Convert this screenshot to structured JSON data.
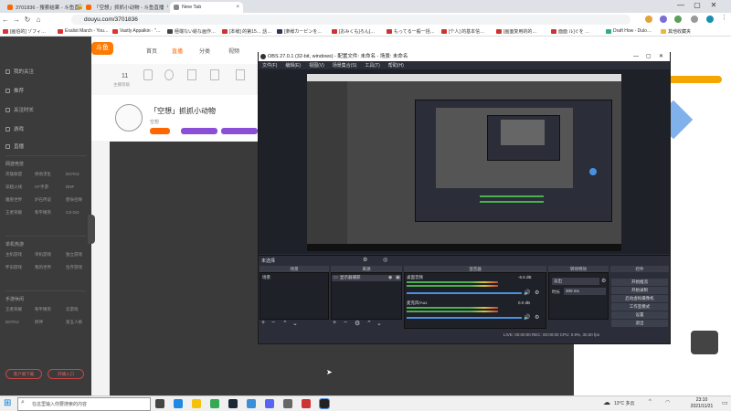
{
  "browser": {
    "tabs": [
      {
        "label": "3701836 - 搜索结果 - 斗鱼直播"
      },
      {
        "label": "「空想」抓抓小动物 - 斗鱼直播"
      },
      {
        "label": "New Tab"
      }
    ],
    "new_tab": "+",
    "address": "douyu.com/3701836",
    "bookmarks": [
      "[画伯的] ゾフィ…",
      "Exalist March - You…",
      "Vastly Appalkin · \"…",
      "極端ない絵な画作…",
      "[本様] 的第15… 話…",
      "[楽様カービンを…",
      "[おみくも]ろん[…",
      "もってる一般一括…",
      "[个人] 的基本信…",
      "[画面复用的的…",
      "面面 ル]ぐを …",
      "Draft How - Dulo…",
      "其他收藏夹"
    ],
    "window_controls": [
      "—",
      "▢",
      "✕"
    ]
  },
  "site": {
    "logo": "斗鱼",
    "nav": [
      "首页",
      "直播",
      "分类",
      "视频"
    ],
    "sidebar": {
      "items": [
        "我的关注",
        "推荐",
        "关注时长",
        "游戏",
        "直播"
      ],
      "sections": [
        {
          "title": "网游竞技",
          "cats": [
            "英雄联盟",
            "绝地求生",
            "DOTA2",
            "穿越火线",
            "CF手游",
            "DNF",
            "魔兽世界",
            "炉石传说",
            "使命召唤",
            "王者荣耀",
            "和平精英",
            "CS:GO"
          ]
        },
        {
          "title": "单机热游",
          "cats": [
            "主机游戏",
            "单机游戏",
            "独立游戏",
            "怀旧游戏",
            "我的世界",
            "生存游戏"
          ]
        },
        {
          "title": "手游休闲",
          "cats": [
            "王者荣耀",
            "和平精英",
            "云游戏",
            "DOTA2",
            "原神",
            "第五人格"
          ]
        }
      ],
      "buttons": [
        "客户端下载",
        "开播入口"
      ]
    },
    "stats": [
      {
        "value": "11",
        "label": "主播等级"
      }
    ],
    "streamer_title": "「空想」抓抓小动物",
    "streamer_sub": "空想"
  },
  "obs": {
    "title": "OBS 27.0.1 (32-bit, windows) - 配置文件: 未命名 - 场景: 未命名",
    "menu": [
      "文件(F)",
      "编辑(E)",
      "视图(V)",
      "场景集合(S)",
      "工具(T)",
      "帮助(H)"
    ],
    "transitions_toolbar": "未选择",
    "docks": [
      "场景",
      "来源",
      "混音器",
      "转场特效",
      "控件"
    ],
    "scene_item": "场景",
    "source_item": "显示器捕获",
    "mixer": [
      {
        "name": "桌面音频",
        "db": "-6.6 dB"
      },
      {
        "name": "麦克风/Aux",
        "db": "0.0 dB"
      }
    ],
    "transition": {
      "type": "淡出",
      "duration_label": "时长",
      "duration": "300 ms"
    },
    "controls": [
      "开始推流",
      "开始录制",
      "启动虚拟摄像机",
      "工作室模式",
      "设置",
      "退出"
    ],
    "status": "LIVE: 00:00:00  REC: 00:00:00  CPU: 0.9%, 30.00 fps"
  },
  "taskbar": {
    "search_placeholder": "在这里输入你要搜索的内容",
    "weather": "13°C 多云",
    "time": "23:10",
    "date": "2021/11/21"
  }
}
